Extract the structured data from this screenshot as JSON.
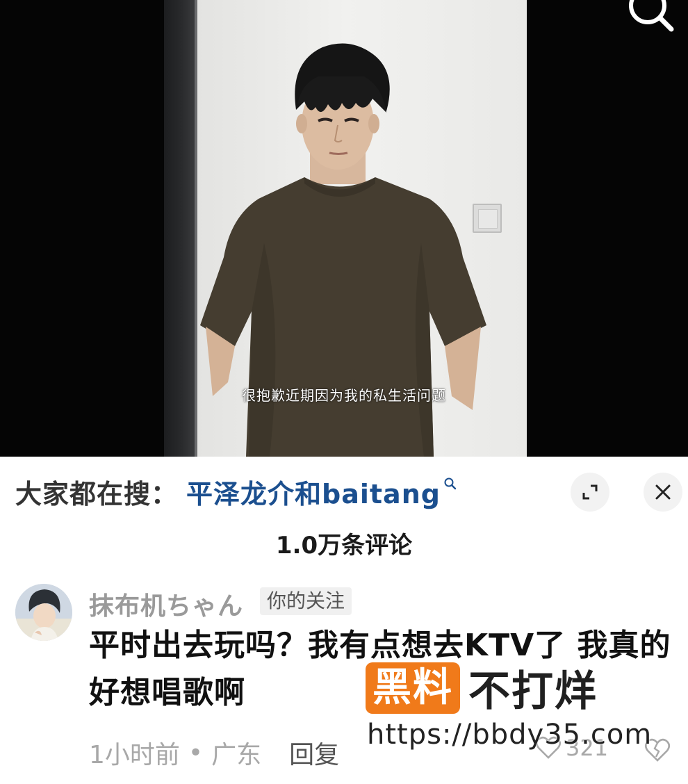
{
  "video": {
    "subtitle": "很抱歉近期因为我的私生活问题"
  },
  "icons": {
    "search": "search-icon",
    "expand": "expand-icon",
    "close": "close-icon",
    "heart": "heart-icon",
    "dislike": "broken-heart-icon"
  },
  "search_suggestion": {
    "prefix": "大家都在搜：",
    "term": "平泽龙介和baitang"
  },
  "comments_header": {
    "count_label": "1.0万条评论"
  },
  "comment": {
    "username": "抹布机ちゃん",
    "badge": "你的关注",
    "text": "平时出去玩吗？我有点想去KTV了 我真的好想唱歌啊",
    "time": "1小时前",
    "dot": "•",
    "location": "广东",
    "reply_label": "回复",
    "likes": "321"
  },
  "watermark": {
    "box_text": "黑料",
    "text": "不打烊",
    "url": "https://bbdy35.com"
  },
  "colors": {
    "accent_blue": "#1b4f8f",
    "watermark_orange": "#f07a1a",
    "video_bg": "#050505"
  }
}
